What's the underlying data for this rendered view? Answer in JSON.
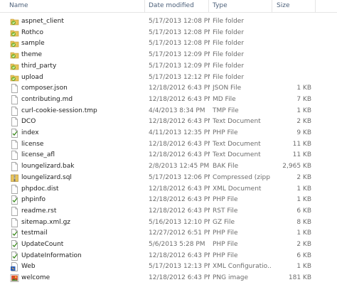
{
  "columns": {
    "name": "Name",
    "date_modified": "Date modified",
    "type": "Type",
    "size": "Size"
  },
  "files": [
    {
      "name": "aspnet_client",
      "date": "5/17/2013 12:08 PM",
      "type": "File folder",
      "size": "",
      "icon": "folder-icon"
    },
    {
      "name": "Rothco",
      "date": "5/17/2013 12:08 PM",
      "type": "File folder",
      "size": "",
      "icon": "folder-icon"
    },
    {
      "name": "sample",
      "date": "5/17/2013 12:08 PM",
      "type": "File folder",
      "size": "",
      "icon": "folder-icon"
    },
    {
      "name": "theme",
      "date": "5/17/2013 12:09 PM",
      "type": "File folder",
      "size": "",
      "icon": "folder-icon"
    },
    {
      "name": "third_party",
      "date": "5/17/2013 12:09 PM",
      "type": "File folder",
      "size": "",
      "icon": "folder-icon"
    },
    {
      "name": "upload",
      "date": "5/17/2013 12:12 PM",
      "type": "File folder",
      "size": "",
      "icon": "folder-icon"
    },
    {
      "name": "composer.json",
      "date": "12/18/2012 6:43 PM",
      "type": "JSON File",
      "size": "1 KB",
      "icon": "blank-file-icon"
    },
    {
      "name": "contributing.md",
      "date": "12/18/2012 6:43 PM",
      "type": "MD File",
      "size": "7 KB",
      "icon": "blank-file-icon"
    },
    {
      "name": "curl-cookie-session.tmp",
      "date": "4/4/2013 8:34 PM",
      "type": "TMP File",
      "size": "1 KB",
      "icon": "blank-file-icon"
    },
    {
      "name": "DCO",
      "date": "12/18/2012 6:43 PM",
      "type": "Text Document",
      "size": "2 KB",
      "icon": "blank-file-icon"
    },
    {
      "name": "index",
      "date": "4/11/2013 12:35 PM",
      "type": "PHP File",
      "size": "9 KB",
      "icon": "php-file-icon"
    },
    {
      "name": "license",
      "date": "12/18/2012 6:43 PM",
      "type": "Text Document",
      "size": "11 KB",
      "icon": "blank-file-icon"
    },
    {
      "name": "license_afl",
      "date": "12/18/2012 6:43 PM",
      "type": "Text Document",
      "size": "11 KB",
      "icon": "blank-file-icon"
    },
    {
      "name": "loungelizard.bak",
      "date": "2/8/2013 12:45 PM",
      "type": "BAK File",
      "size": "2,965 KB",
      "icon": "blank-file-icon"
    },
    {
      "name": "loungelizard.sql",
      "date": "5/17/2013 12:06 PM",
      "type": "Compressed (zipp...",
      "size": "2 KB",
      "icon": "zip-file-icon"
    },
    {
      "name": "phpdoc.dist",
      "date": "12/18/2012 6:43 PM",
      "type": "XML Document",
      "size": "1 KB",
      "icon": "blank-file-icon"
    },
    {
      "name": "phpinfo",
      "date": "12/18/2012 6:43 PM",
      "type": "PHP File",
      "size": "1 KB",
      "icon": "php-file-icon"
    },
    {
      "name": "readme.rst",
      "date": "12/18/2012 6:43 PM",
      "type": "RST File",
      "size": "6 KB",
      "icon": "blank-file-icon"
    },
    {
      "name": "sitemap.xml.gz",
      "date": "5/16/2013 12:10 PM",
      "type": "GZ File",
      "size": "8 KB",
      "icon": "blank-file-icon"
    },
    {
      "name": "testmail",
      "date": "12/27/2012 6:51 PM",
      "type": "PHP File",
      "size": "1 KB",
      "icon": "php-file-icon"
    },
    {
      "name": "UpdateCount",
      "date": "5/6/2013 5:28 PM",
      "type": "PHP File",
      "size": "2 KB",
      "icon": "php-file-icon"
    },
    {
      "name": "UpdateInformation",
      "date": "12/18/2012 6:43 PM",
      "type": "PHP File",
      "size": "6 KB",
      "icon": "php-file-icon"
    },
    {
      "name": "Web",
      "date": "5/17/2013 12:13 PM",
      "type": "XML Configuratio...",
      "size": "1 KB",
      "icon": "xml-config-icon"
    },
    {
      "name": "welcome",
      "date": "12/18/2012 6:43 PM",
      "type": "PNG image",
      "size": "181 KB",
      "icon": "png-image-icon"
    }
  ]
}
